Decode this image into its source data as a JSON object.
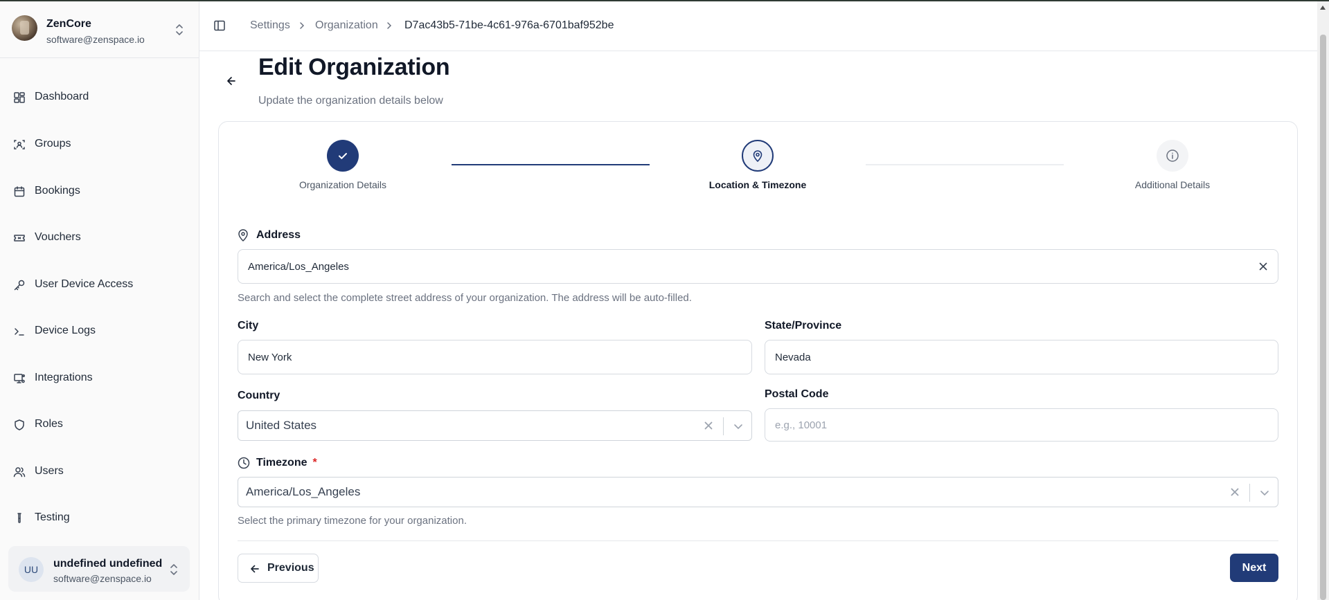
{
  "sidebar": {
    "brand_name": "ZenCore",
    "brand_email": "software@zenspace.io",
    "items": [
      {
        "label": "Dashboard",
        "icon": "dashboard-icon"
      },
      {
        "label": "Groups",
        "icon": "groups-icon"
      },
      {
        "label": "Bookings",
        "icon": "calendar-icon"
      },
      {
        "label": "Vouchers",
        "icon": "ticket-icon"
      },
      {
        "label": "User Device Access",
        "icon": "key-icon"
      },
      {
        "label": "Device Logs",
        "icon": "terminal-icon"
      },
      {
        "label": "Integrations",
        "icon": "integrations-icon"
      },
      {
        "label": "Roles",
        "icon": "shield-icon"
      },
      {
        "label": "Users",
        "icon": "users-icon"
      },
      {
        "label": "Testing",
        "icon": "test-tube-icon"
      }
    ],
    "user": {
      "initials": "UU",
      "name": "undefined undefined",
      "email": "software@zenspace.io"
    }
  },
  "header": {
    "breadcrumbs": [
      "Settings",
      "Organization",
      "D7ac43b5-71be-4c61-976a-6701baf952be"
    ]
  },
  "page": {
    "title": "Edit Organization",
    "subtitle": "Update the organization details below"
  },
  "stepper": {
    "steps": [
      {
        "label": "Organization Details",
        "state": "completed"
      },
      {
        "label": "Location & Timezone",
        "state": "active"
      },
      {
        "label": "Additional Details",
        "state": "pending"
      }
    ]
  },
  "form": {
    "address": {
      "label": "Address",
      "value": "America/Los_Angeles",
      "helper": "Search and select the complete street address of your organization. The address will be auto-filled."
    },
    "city": {
      "label": "City",
      "value": "New York"
    },
    "state": {
      "label": "State/Province",
      "value": "Nevada"
    },
    "country": {
      "label": "Country",
      "value": "United States"
    },
    "postal": {
      "label": "Postal Code",
      "value": "",
      "placeholder": "e.g., 10001"
    },
    "timezone": {
      "label": "Timezone",
      "required_mark": "*",
      "value": "America/Los_Angeles",
      "helper": "Select the primary timezone for your organization."
    }
  },
  "actions": {
    "previous_label": "Previous",
    "next_label": "Next"
  },
  "colors": {
    "primary": "#213b78",
    "required": "#dc2626"
  }
}
